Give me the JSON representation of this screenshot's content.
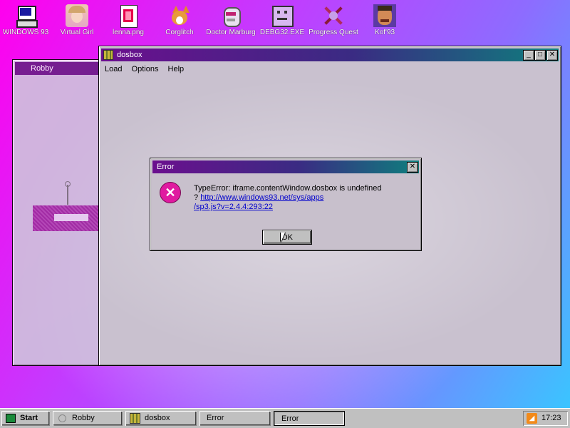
{
  "desktop_icons": [
    {
      "label": "WINDOWS 93",
      "icon": "computer-icon"
    },
    {
      "label": "Virtual Girl",
      "icon": "virtual-girl-icon"
    },
    {
      "label": "lenna.png",
      "icon": "image-file-icon"
    },
    {
      "label": "Corglitch",
      "icon": "corgi-icon"
    },
    {
      "label": "Doctor Marburg",
      "icon": "doctor-icon"
    },
    {
      "label": "DEBG32.EXE",
      "icon": "debug-screen-icon"
    },
    {
      "label": "Progress Quest",
      "icon": "crossed-swords-icon"
    },
    {
      "label": "Kof'93",
      "icon": "fighter-face-icon"
    }
  ],
  "robby_window": {
    "title": "Robby"
  },
  "dosbox_window": {
    "title": "dosbox",
    "menu": [
      "Load",
      "Options",
      "Help"
    ],
    "buttons": {
      "minimize": "_",
      "maximize": "□",
      "close": "✕"
    }
  },
  "error_dialog": {
    "title": "Error",
    "message_line1": "TypeError: iframe.contentWindow.dosbox is undefined",
    "message_prefix": "?",
    "link_line1": "http://www.windows93.net/sys/apps",
    "link_line2": "/sp3.js?v=2.4.4:293:22",
    "ok_label": "OK",
    "close": "✕"
  },
  "taskbar": {
    "start_label": "Start",
    "items": [
      "Robby",
      "dosbox",
      "Error",
      "Error"
    ],
    "clock": "17:23"
  },
  "colors": {
    "accent": "#6b0f8e",
    "error_icon": "#e01aa0",
    "link": "#0000cc"
  }
}
